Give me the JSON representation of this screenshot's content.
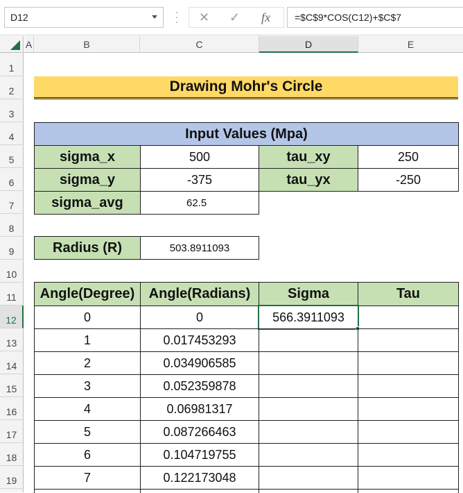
{
  "formula_bar": {
    "name_box": "D12",
    "cancel_glyph": "✕",
    "enter_glyph": "✓",
    "fx_glyph": "fx",
    "formula": "=$C$9*COS(C12)+$C$7"
  },
  "columns": [
    "A",
    "B",
    "C",
    "D",
    "E"
  ],
  "rows": [
    "1",
    "2",
    "3",
    "4",
    "5",
    "6",
    "7",
    "8",
    "9",
    "10",
    "11",
    "12",
    "13",
    "14",
    "15",
    "16",
    "17",
    "18",
    "19"
  ],
  "title": "Drawing Mohr's Circle",
  "inputs": {
    "header": "Input Values (Mpa)",
    "sigma_x_label": "sigma_x",
    "sigma_x": "500",
    "sigma_y_label": "sigma_y",
    "sigma_y": "-375",
    "sigma_avg_label": "sigma_avg",
    "sigma_avg": "62.5",
    "tau_xy_label": "tau_xy",
    "tau_xy": "250",
    "tau_yx_label": "tau_yx",
    "tau_yx": "-250"
  },
  "radius": {
    "label": "Radius (R)",
    "value": "503.8911093"
  },
  "table": {
    "headers": [
      "Angle(Degree)",
      "Angle(Radians)",
      "Sigma",
      "Tau"
    ],
    "rows": [
      [
        "0",
        "0",
        "566.3911093",
        ""
      ],
      [
        "1",
        "0.017453293",
        "",
        ""
      ],
      [
        "2",
        "0.034906585",
        "",
        ""
      ],
      [
        "3",
        "0.052359878",
        "",
        ""
      ],
      [
        "4",
        "0.06981317",
        "",
        ""
      ],
      [
        "5",
        "0.087266463",
        "",
        ""
      ],
      [
        "6",
        "0.104719755",
        "",
        ""
      ],
      [
        "7",
        "0.122173048",
        "",
        ""
      ]
    ]
  }
}
